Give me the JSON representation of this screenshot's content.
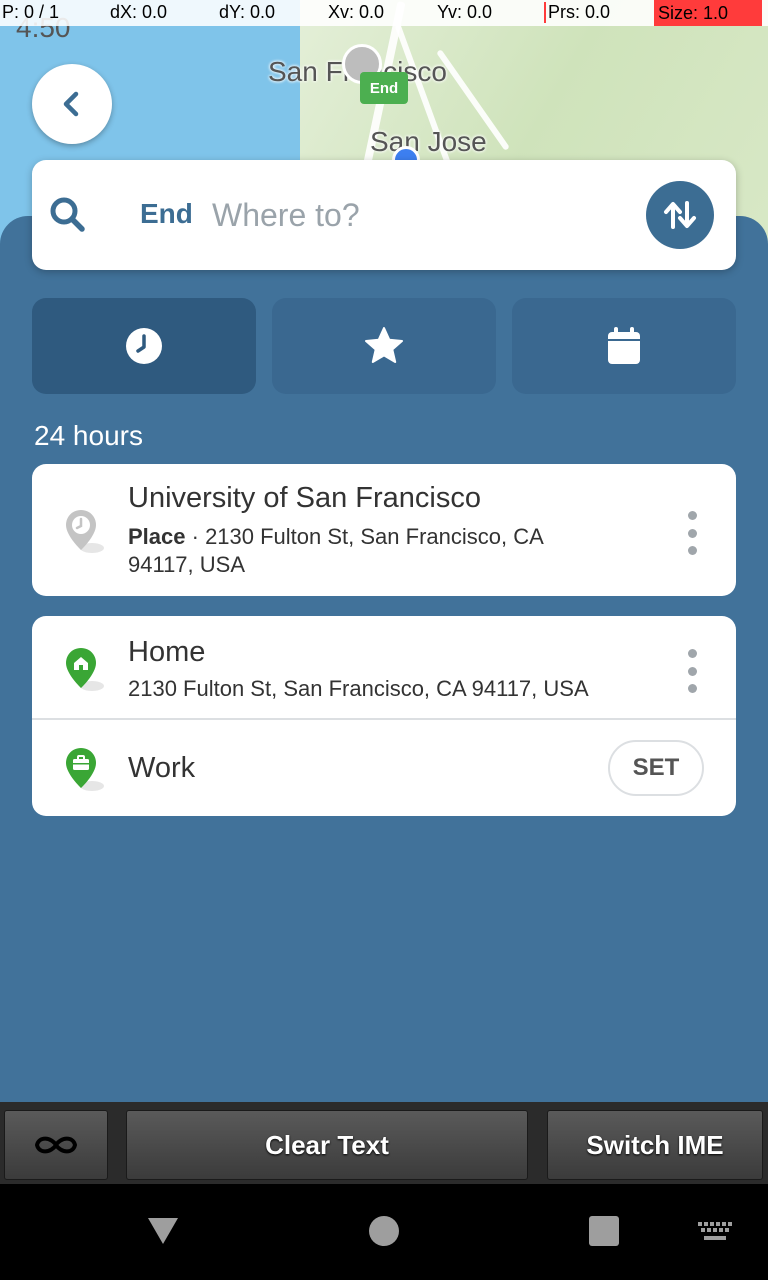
{
  "status": {
    "p": "P: 0 / 1",
    "dx": "dX: 0.0",
    "dy": "dY: 0.0",
    "xv": "Xv: 0.0",
    "yv": "Yv: 0.0",
    "prs": "Prs: 0.0",
    "size": "Size: 1.0",
    "time": "4:50"
  },
  "map": {
    "city1": "San Francisco",
    "city2": "San Jose",
    "end_tag": "End"
  },
  "search": {
    "label": "End",
    "placeholder": "Where to?"
  },
  "section_title": "24 hours",
  "recent_items": [
    {
      "title": "University of San Francisco",
      "type": "Place",
      "separator": " · ",
      "address": "2130 Fulton St, San Francisco, CA 94117, USA"
    }
  ],
  "saved_items": [
    {
      "title": "Home",
      "address": "2130 Fulton St, San Francisco, CA 94117, USA"
    },
    {
      "title": "Work",
      "action": "SET"
    }
  ],
  "ime": {
    "clear_label": "Clear Text",
    "switch_label": "Switch IME"
  },
  "colors": {
    "panel": "#41729a",
    "accent": "#3c6d93",
    "pin_green": "#3aa635",
    "pin_gray": "#bdbdbd"
  }
}
